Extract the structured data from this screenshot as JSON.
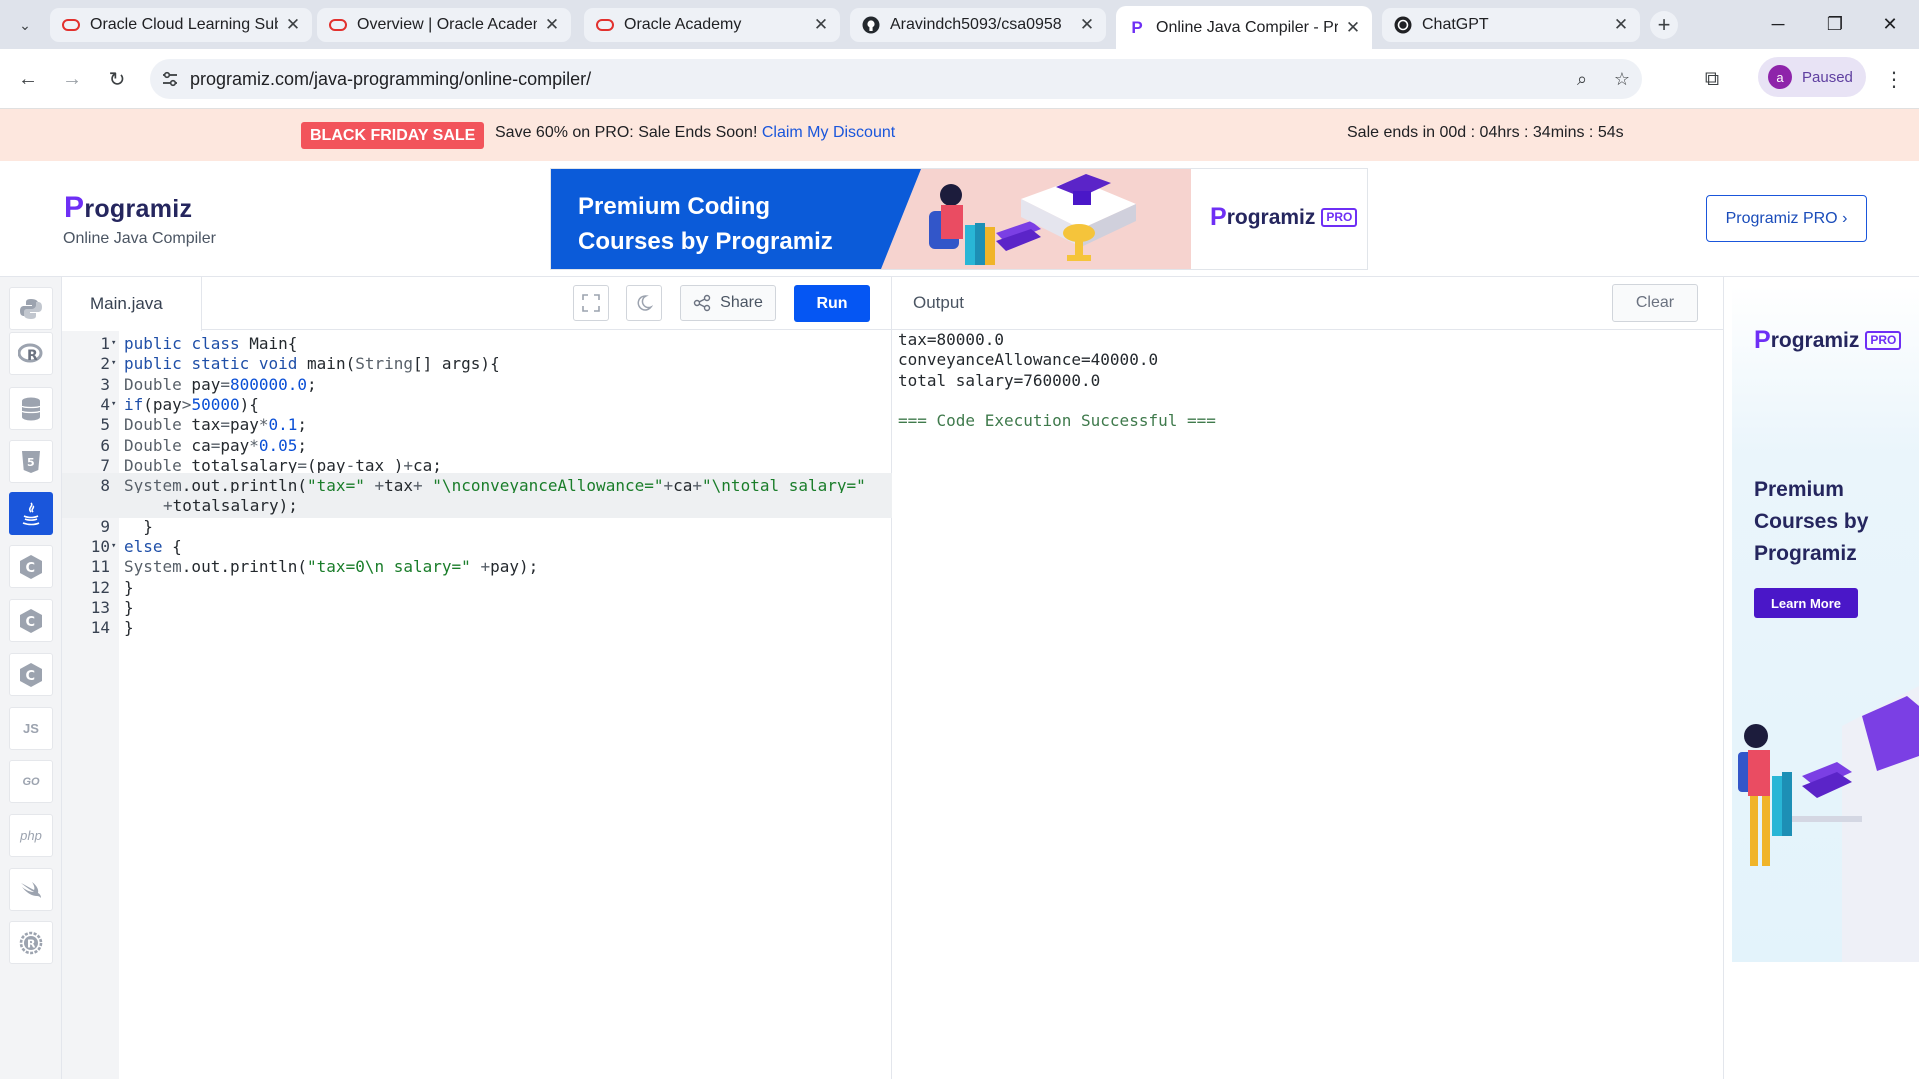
{
  "browser": {
    "tabs": [
      {
        "title": "Oracle Cloud Learning Sub",
        "favicon": "oracle-icon"
      },
      {
        "title": "Overview | Oracle Academy",
        "favicon": "oracle-icon"
      },
      {
        "title": "Oracle Academy",
        "favicon": "oracle-icon"
      },
      {
        "title": "Aravindch5093/csa0958",
        "favicon": "github-icon"
      },
      {
        "title": "Online Java Compiler - Pro",
        "favicon": "programiz-icon"
      },
      {
        "title": "ChatGPT",
        "favicon": "chatgpt-icon"
      }
    ],
    "url": "programiz.com/java-programming/online-compiler/",
    "profile_initial": "a",
    "profile_label": "Paused"
  },
  "promo": {
    "badge": "BLACK FRIDAY SALE",
    "text": "Save 60% on PRO: Sale Ends Soon! ",
    "link": "Claim My Discount",
    "countdown": "Sale ends in 00d : 04hrs : 34mins : 54s"
  },
  "header": {
    "logo": "rogramiz",
    "logo_initial": "P",
    "subtitle": "Online Java Compiler",
    "ad_headline_1": "Premium Coding",
    "ad_headline_2": "Courses by Programiz",
    "ad_logo": "rogramiz",
    "ad_logo_initial": "P",
    "ad_pro_tag": "PRO",
    "pro_button": "Programiz PRO ›"
  },
  "languages": [
    "python",
    "r",
    "sql",
    "html",
    "java",
    "c",
    "cpp",
    "csharp",
    "JS",
    "GO",
    "php",
    "swift",
    "rust"
  ],
  "editor": {
    "file_name": "Main.java",
    "share_label": "Share",
    "run_label": "Run"
  },
  "code_lines": [
    {
      "n": "1",
      "fold": "▾",
      "html": "<span class=\"k\">public</span> <span class=\"k\">class</span> Main{"
    },
    {
      "n": "2",
      "fold": "▾",
      "html": "<span class=\"k\">public</span> <span class=\"k\">static</span> <span class=\"k\">void</span> main(<span class=\"t\">String</span>[] args){"
    },
    {
      "n": "3",
      "fold": "",
      "html": "<span class=\"t\">Double</span> pay<span class=\"t\">=</span><span class=\"n\">800000.0</span>;"
    },
    {
      "n": "4",
      "fold": "▾",
      "html": "<span class=\"k\">if</span>(pay<span class=\"t\">&gt;</span><span class=\"n\">50000</span>){"
    },
    {
      "n": "5",
      "fold": "",
      "html": "<span class=\"t\">Double</span> tax<span class=\"t\">=</span>pay<span class=\"t\">*</span><span class=\"n\">0.1</span>;"
    },
    {
      "n": "6",
      "fold": "",
      "html": "<span class=\"t\">Double</span> ca<span class=\"t\">=</span>pay<span class=\"t\">*</span><span class=\"n\">0.05</span>;"
    },
    {
      "n": "7",
      "fold": "",
      "html": "<span class=\"t\">Double</span> totalsalary<span class=\"t\">=</span>(pay<span class=\"t\">-</span>tax )<span class=\"t\">+</span>ca;"
    },
    {
      "n": "8",
      "fold": "",
      "html": "<span class=\"t\">System</span>.out.println(<span class=\"s\">\"tax=\"</span> <span class=\"t\">+</span>tax<span class=\"t\">+</span> <span class=\"s\">\"\\nconveyanceAllowance=\"</span><span class=\"t\">+</span>ca<span class=\"t\">+</span><span class=\"s\">\"\\ntotal salary=\"</span>"
    },
    {
      "n": "",
      "fold": "",
      "wrap": true,
      "html": "<span class=\"t\">+</span>totalsalary);"
    },
    {
      "n": "9",
      "fold": "",
      "html": "  }"
    },
    {
      "n": "10",
      "fold": "▾",
      "html": "<span class=\"k\">else</span> {"
    },
    {
      "n": "11",
      "fold": "",
      "html": "<span class=\"t\">System</span>.out.println(<span class=\"s\">\"tax=0\\n salary=\"</span> <span class=\"t\">+</span>pay);"
    },
    {
      "n": "12",
      "fold": "",
      "html": "}"
    },
    {
      "n": "13",
      "fold": "",
      "html": "}"
    },
    {
      "n": "14",
      "fold": "",
      "html": "}"
    }
  ],
  "output": {
    "title": "Output",
    "clear_label": "Clear",
    "lines": [
      "tax=80000.0",
      "conveyanceAllowance=40000.0",
      "total salary=760000.0",
      "",
      "=== Code Execution Successful ==="
    ]
  },
  "side_ad": {
    "logo": "rogramiz",
    "logo_initial": "P",
    "pro_tag": "PRO",
    "headline_1": "Premium",
    "headline_2": "Courses by",
    "headline_3": "Programiz",
    "button": "Learn More"
  },
  "colors": {
    "run_button": "#0556f3",
    "active_language": "#1a56db",
    "promo_background": "#fde7de",
    "sale_badge": "#f2545b"
  }
}
